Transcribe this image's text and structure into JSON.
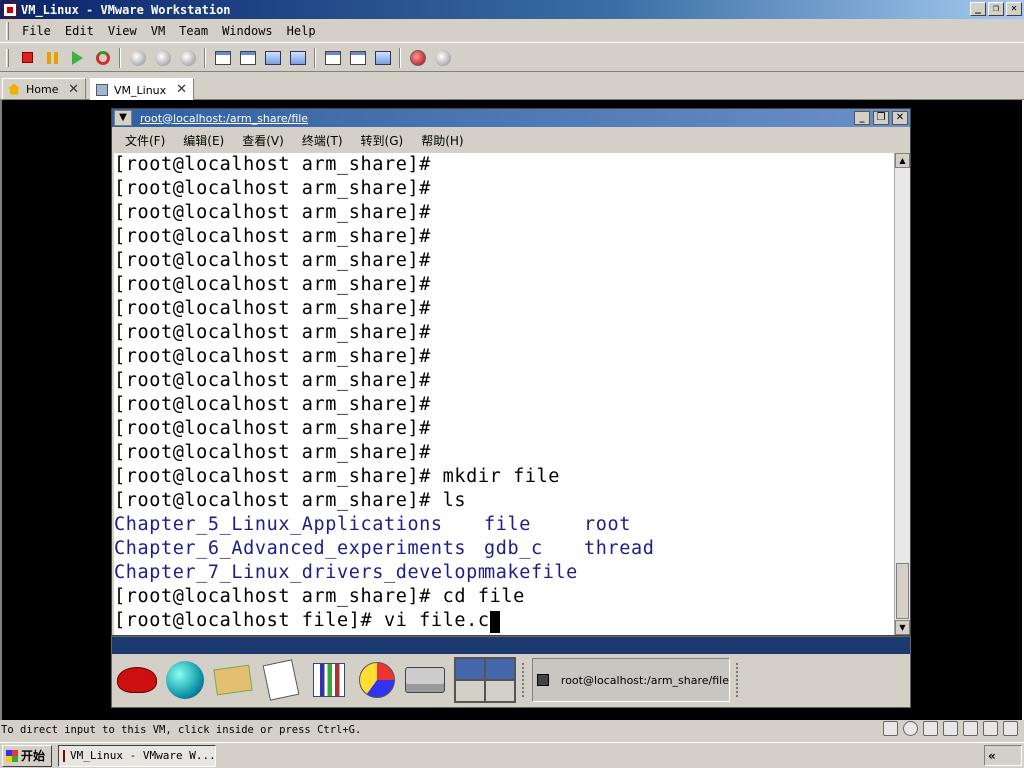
{
  "window": {
    "title": "VM_Linux - VMware Workstation",
    "controls": [
      "_",
      "❐",
      "✕"
    ]
  },
  "menubar": [
    "File",
    "Edit",
    "View",
    "VM",
    "Team",
    "Windows",
    "Help"
  ],
  "tabs": [
    {
      "label": "Home"
    },
    {
      "label": "VM_Linux"
    }
  ],
  "terminal": {
    "title": "root@localhost:/arm_share/file",
    "menu": [
      "文件(F)",
      "编辑(E)",
      "查看(V)",
      "终端(T)",
      "转到(G)",
      "帮助(H)"
    ],
    "lines": [
      "[root@localhost arm_share]#",
      "[root@localhost arm_share]#",
      "[root@localhost arm_share]#",
      "[root@localhost arm_share]#",
      "[root@localhost arm_share]#",
      "[root@localhost arm_share]#",
      "[root@localhost arm_share]#",
      "[root@localhost arm_share]#",
      "[root@localhost arm_share]#",
      "[root@localhost arm_share]#",
      "[root@localhost arm_share]#",
      "[root@localhost arm_share]#",
      "[root@localhost arm_share]#",
      "[root@localhost arm_share]# mkdir file",
      "[root@localhost arm_share]# ls"
    ],
    "ls_output": [
      [
        "Chapter_5_Linux_Applications",
        "file",
        "root"
      ],
      [
        "Chapter_6_Advanced_experiments",
        "gdb_c",
        "thread"
      ],
      [
        "Chapter_7_Linux_drivers_development",
        "makefile",
        ""
      ]
    ],
    "after_lines": [
      "[root@localhost arm_share]# cd file"
    ],
    "current_line": "[root@localhost file]# vi file.c"
  },
  "guest_panel": {
    "task_label": "root@localhost:/arm_share/file"
  },
  "status": {
    "message": "To direct input to this VM, click inside or press Ctrl+G."
  },
  "taskbar": {
    "start_label": "开始",
    "task_label": "VM_Linux - VMware W...",
    "tray_label": "«"
  }
}
